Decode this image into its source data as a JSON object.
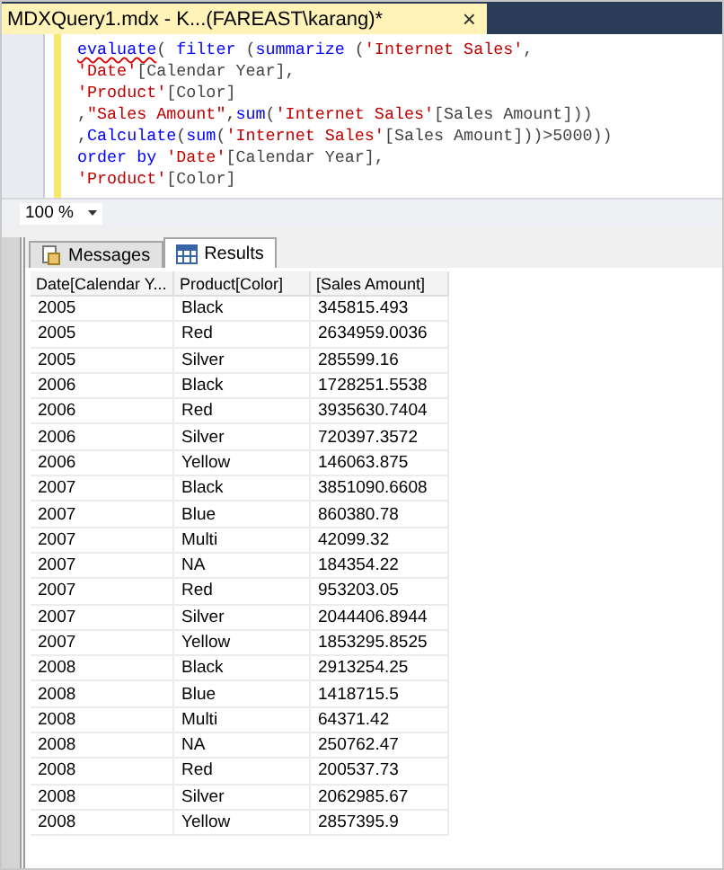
{
  "document_tab": {
    "title": "MDXQuery1.mdx - K...(FAREAST\\karang)*",
    "close": "×",
    "selected": true
  },
  "editor": {
    "lines": [
      [
        {
          "text": "evaluate",
          "kind": "error"
        },
        {
          "text": "( ",
          "kind": "text"
        },
        {
          "text": "filter",
          "kind": "keyword"
        },
        {
          "text": " (",
          "kind": "text"
        },
        {
          "text": "summarize",
          "kind": "keyword"
        },
        {
          "text": " (",
          "kind": "text"
        },
        {
          "text": "'Internet Sales'",
          "kind": "string"
        },
        {
          "text": ",",
          "kind": "text"
        }
      ],
      [
        {
          "text": "'Date'",
          "kind": "string"
        },
        {
          "text": "[Calendar Year],",
          "kind": "text"
        }
      ],
      [
        {
          "text": "'Product'",
          "kind": "string"
        },
        {
          "text": "[Color]",
          "kind": "text"
        }
      ],
      [
        {
          "text": ",",
          "kind": "text"
        },
        {
          "text": "\"Sales Amount\"",
          "kind": "string"
        },
        {
          "text": ",",
          "kind": "text"
        },
        {
          "text": "sum",
          "kind": "keyword"
        },
        {
          "text": "(",
          "kind": "text"
        },
        {
          "text": "'Internet Sales'",
          "kind": "string"
        },
        {
          "text": "[Sales Amount]))",
          "kind": "text"
        }
      ],
      [
        {
          "text": ",",
          "kind": "text"
        },
        {
          "text": "Calculate",
          "kind": "keyword"
        },
        {
          "text": "(",
          "kind": "text"
        },
        {
          "text": "sum",
          "kind": "keyword"
        },
        {
          "text": "(",
          "kind": "text"
        },
        {
          "text": "'Internet Sales'",
          "kind": "string"
        },
        {
          "text": "[Sales Amount]))>5000))",
          "kind": "text"
        }
      ],
      [
        {
          "text": "order by ",
          "kind": "keyword"
        },
        {
          "text": "'Date'",
          "kind": "string"
        },
        {
          "text": "[Calendar Year],",
          "kind": "text"
        }
      ],
      [
        {
          "text": "'Product'",
          "kind": "string"
        },
        {
          "text": "[Color]",
          "kind": "text"
        }
      ]
    ]
  },
  "zoom": {
    "value": "100 %"
  },
  "result_tabs": [
    {
      "label": "Messages",
      "kind": "messages",
      "selected": false
    },
    {
      "label": "Results",
      "kind": "results",
      "selected": true
    }
  ],
  "table": {
    "columns": [
      "Date[Calendar Y...",
      "Product[Color]",
      "[Sales Amount]"
    ],
    "rows": [
      [
        "2005",
        "Black",
        "345815.493"
      ],
      [
        "2005",
        "Red",
        "2634959.0036"
      ],
      [
        "2005",
        "Silver",
        "285599.16"
      ],
      [
        "2006",
        "Black",
        "1728251.5538"
      ],
      [
        "2006",
        "Red",
        "3935630.7404"
      ],
      [
        "2006",
        "Silver",
        "720397.3572"
      ],
      [
        "2006",
        "Yellow",
        "146063.875"
      ],
      [
        "2007",
        "Black",
        "3851090.6608"
      ],
      [
        "2007",
        "Blue",
        "860380.78"
      ],
      [
        "2007",
        "Multi",
        "42099.32"
      ],
      [
        "2007",
        "NA",
        "184354.22"
      ],
      [
        "2007",
        "Red",
        "953203.05"
      ],
      [
        "2007",
        "Silver",
        "2044406.8944"
      ],
      [
        "2007",
        "Yellow",
        "1853295.8525"
      ],
      [
        "2008",
        "Black",
        "2913254.25"
      ],
      [
        "2008",
        "Blue",
        "1418715.5"
      ],
      [
        "2008",
        "Multi",
        "64371.42"
      ],
      [
        "2008",
        "NA",
        "250762.47"
      ],
      [
        "2008",
        "Red",
        "200537.73"
      ],
      [
        "2008",
        "Silver",
        "2062985.67"
      ],
      [
        "2008",
        "Yellow",
        "2857395.9"
      ]
    ]
  }
}
